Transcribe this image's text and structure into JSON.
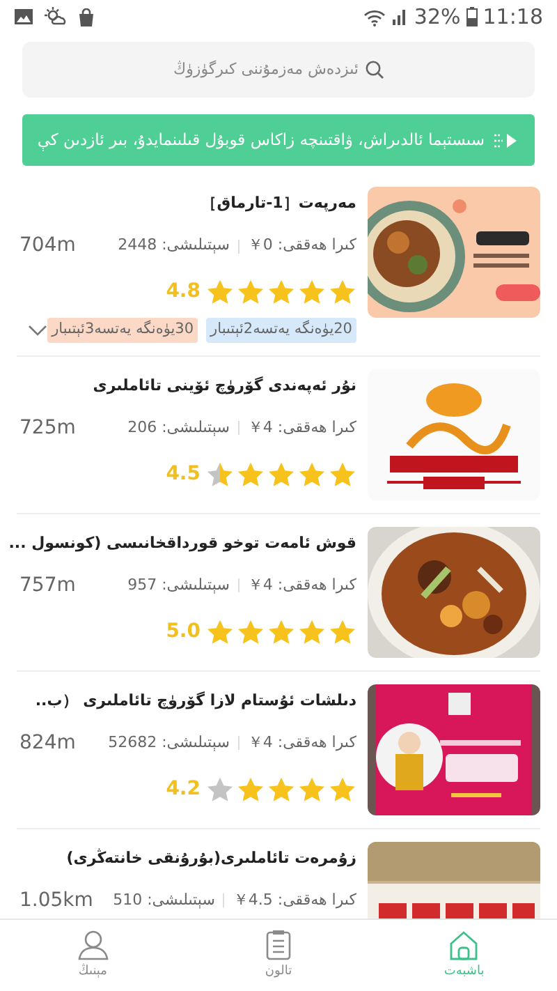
{
  "status_bar": {
    "battery": "32%",
    "time": "11:18"
  },
  "search": {
    "placeholder": "ئىزدەش مەزمۇننى كىرگۈزۈڭ"
  },
  "notice": {
    "text": "سىستېما ئالدىراش، ۋاقتىنچە زاكاس قوبۇل قىلىنمايدۇ، بىر ئازدىن كې"
  },
  "restaurants": [
    {
      "name": "مەرپەت［1-تارماق］",
      "fee": "كىرا ھەققى: 0￥",
      "sales": "سېتىلىشى: 2448",
      "distance": "704m",
      "rating": "4.8",
      "stars": 5,
      "tags": [
        {
          "text": "20يۈەنگە يەتسە2ئېتىبار",
          "color": "#d6e9fb"
        },
        {
          "text": "30يۈەنگە يەتسە3ئېتىبار",
          "color": "#fbd9c6"
        }
      ],
      "expand": true
    },
    {
      "name": "نۇر ئەپەندى گۆرۈچ ئۆينى تائاملىرى",
      "fee": "كىرا ھەققى: 4￥",
      "sales": "سېتىلىشى: 206",
      "distance": "725m",
      "rating": "4.5",
      "stars": 4.5
    },
    {
      "name": "قوش ئامەت توخو قورداقخانىسى (كونسول ...",
      "fee": "كىرا ھەققى: 4￥",
      "sales": "سېتىلىشى: 957",
      "distance": "757m",
      "rating": "5.0",
      "stars": 5
    },
    {
      "name": "دىلشات ئۇستام لازا گۆرۈچ تائاملىرى （ب..",
      "fee": "كىرا ھەققى: 4￥",
      "sales": "سېتىلىشى: 52682",
      "distance": "824m",
      "rating": "4.2",
      "stars": 4
    },
    {
      "name": "زۇمرەت تائاملىرى(بۇرۇنقى خانتەڭرى)",
      "fee": "كىرا ھەققى: 4.5￥",
      "sales": "سېتىلىشى: 510",
      "distance": "1.05km"
    }
  ],
  "bottom_nav": [
    {
      "label": "باشبەت",
      "selected": true
    },
    {
      "label": "تالون",
      "selected": false
    },
    {
      "label": "مېنىڭ",
      "selected": false
    }
  ]
}
